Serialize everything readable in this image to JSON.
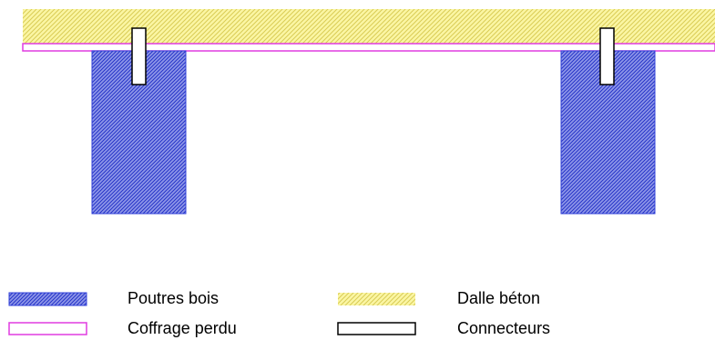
{
  "colors": {
    "timber_fill": "#8f97e8",
    "timber_hatch": "#2433c8",
    "timber_edge": "#3040d8",
    "concrete_fill": "#fbf6a4",
    "concrete_hatch": "#d9cc55",
    "formwork_line": "#e03ce0",
    "connector_edge": "#000000",
    "connector_fill": "#ffffff"
  },
  "legend": {
    "timber_beams": "Poutres bois",
    "concrete_slab": "Dalle béton",
    "lost_formwork": "Coffrage perdu",
    "connectors": "Connecteurs"
  }
}
